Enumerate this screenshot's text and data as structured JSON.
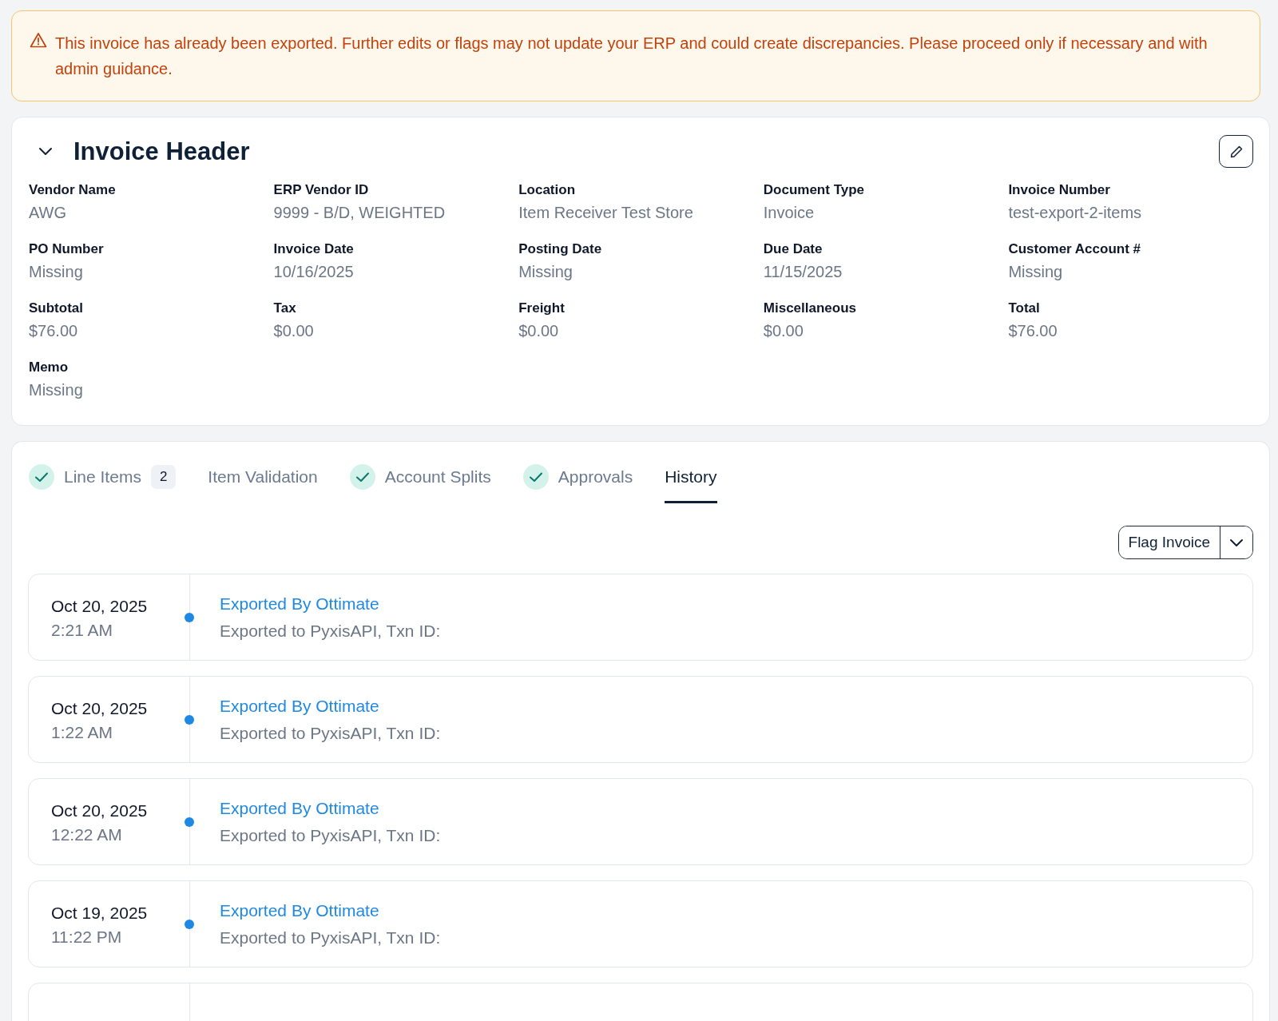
{
  "alert": {
    "text": "This invoice has already been exported. Further edits or flags may not update your ERP and could create discrepancies. Please proceed only if necessary and with admin guidance."
  },
  "invoice_header": {
    "title": "Invoice Header",
    "expanded": true,
    "fields": [
      {
        "label": "Vendor Name",
        "value": "AWG"
      },
      {
        "label": "ERP Vendor ID",
        "value": "9999 - B/D, WEIGHTED"
      },
      {
        "label": "Location",
        "value": "Item Receiver Test Store"
      },
      {
        "label": "Document Type",
        "value": "Invoice"
      },
      {
        "label": "Invoice Number",
        "value": "test-export-2-items"
      },
      {
        "label": "PO Number",
        "value": "Missing"
      },
      {
        "label": "Invoice Date",
        "value": "10/16/2025"
      },
      {
        "label": "Posting Date",
        "value": "Missing"
      },
      {
        "label": "Due Date",
        "value": "11/15/2025"
      },
      {
        "label": "Customer Account #",
        "value": "Missing"
      },
      {
        "label": "Subtotal",
        "value": "$76.00"
      },
      {
        "label": "Tax",
        "value": "$0.00"
      },
      {
        "label": "Freight",
        "value": "$0.00"
      },
      {
        "label": "Miscellaneous",
        "value": "$0.00"
      },
      {
        "label": "Total",
        "value": "$76.00"
      },
      {
        "label": "Memo",
        "value": "Missing"
      }
    ]
  },
  "tabs": [
    {
      "label": "Line Items",
      "complete": true,
      "count": "2",
      "selected": false
    },
    {
      "label": "Item Validation",
      "complete": false,
      "selected": false
    },
    {
      "label": "Account Splits",
      "complete": true,
      "selected": false
    },
    {
      "label": "Approvals",
      "complete": true,
      "selected": false
    },
    {
      "label": "History",
      "complete": false,
      "selected": true
    }
  ],
  "flag_button": {
    "label": "Flag Invoice"
  },
  "history": [
    {
      "date": "Oct 20, 2025",
      "time": "2:21 AM",
      "title": "Exported By Ottimate",
      "detail": "Exported to PyxisAPI, Txn ID:"
    },
    {
      "date": "Oct 20, 2025",
      "time": "1:22 AM",
      "title": "Exported By Ottimate",
      "detail": "Exported to PyxisAPI, Txn ID:"
    },
    {
      "date": "Oct 20, 2025",
      "time": "12:22 AM",
      "title": "Exported By Ottimate",
      "detail": "Exported to PyxisAPI, Txn ID:"
    },
    {
      "date": "Oct 19, 2025",
      "time": "11:22 PM",
      "title": "Exported By Ottimate",
      "detail": "Exported to PyxisAPI, Txn ID:"
    }
  ]
}
